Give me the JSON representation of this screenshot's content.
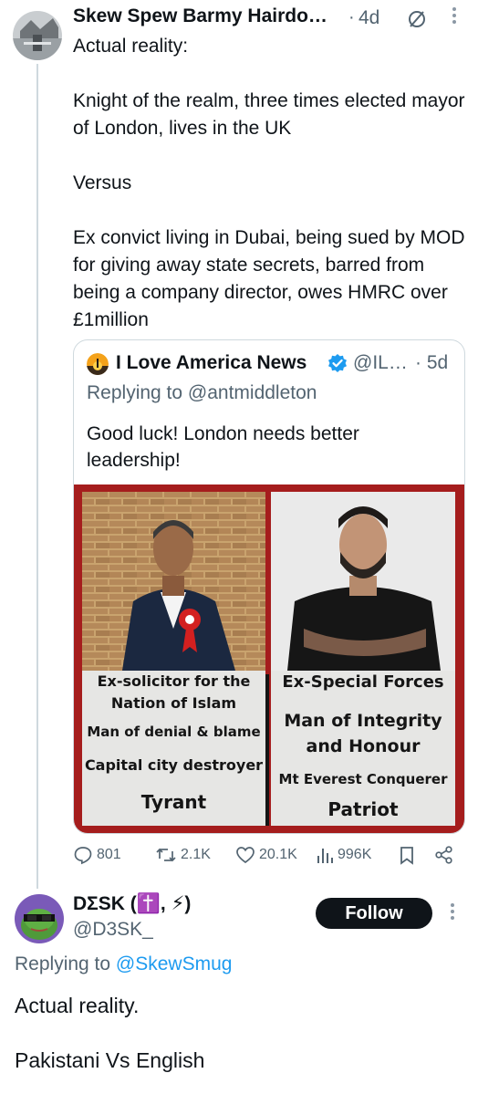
{
  "tweet": {
    "author_name": "Skew Spew Barmy Hairdo…",
    "time_sep": "·",
    "time": "4d",
    "text": "Actual reality:\n\nKnight of the realm, three times elected mayor of London, lives in the UK\n\nVersus\n\nEx convict living in Dubai, being sued by MOD for giving away state secrets, barred from being a company director, owes HMRC over £1million",
    "more_icon": "more-vertical-icon",
    "grok_icon": "slashed-circle-icon"
  },
  "quote": {
    "author_name": "I Love America News",
    "handle": "@IL…",
    "time": "· 5d",
    "reply_text": "Replying to @antmiddleton",
    "text": "Good luck! London needs better leadership!",
    "verified_color": "#1d9bf0",
    "image": {
      "left_lines": [
        "Ex-solicitor for the",
        "Nation of Islam",
        "Man of denial & blame",
        "Capital city destroyer",
        "Tyrant"
      ],
      "right_lines": [
        "Ex-Special Forces",
        "Man of Integrity",
        "and Honour",
        "Mt Everest Conquerer",
        "Patriot"
      ],
      "border_color": "#a51d1d"
    }
  },
  "actions": {
    "replies": "801",
    "reposts": "2.1K",
    "likes": "20.1K",
    "views": "996K"
  },
  "reply": {
    "author_name": "DΣSK (✝️, ⚡)",
    "handle": "@D3SK_",
    "follow_label": "Follow",
    "replying_prefix": "Replying to ",
    "replying_handle": "@SkewSmug",
    "text": "Actual reality.\n\nPakistani Vs English"
  },
  "colors": {
    "link": "#1d9bf0",
    "secondary_text": "#536471",
    "thread_line": "#cfd9de"
  }
}
